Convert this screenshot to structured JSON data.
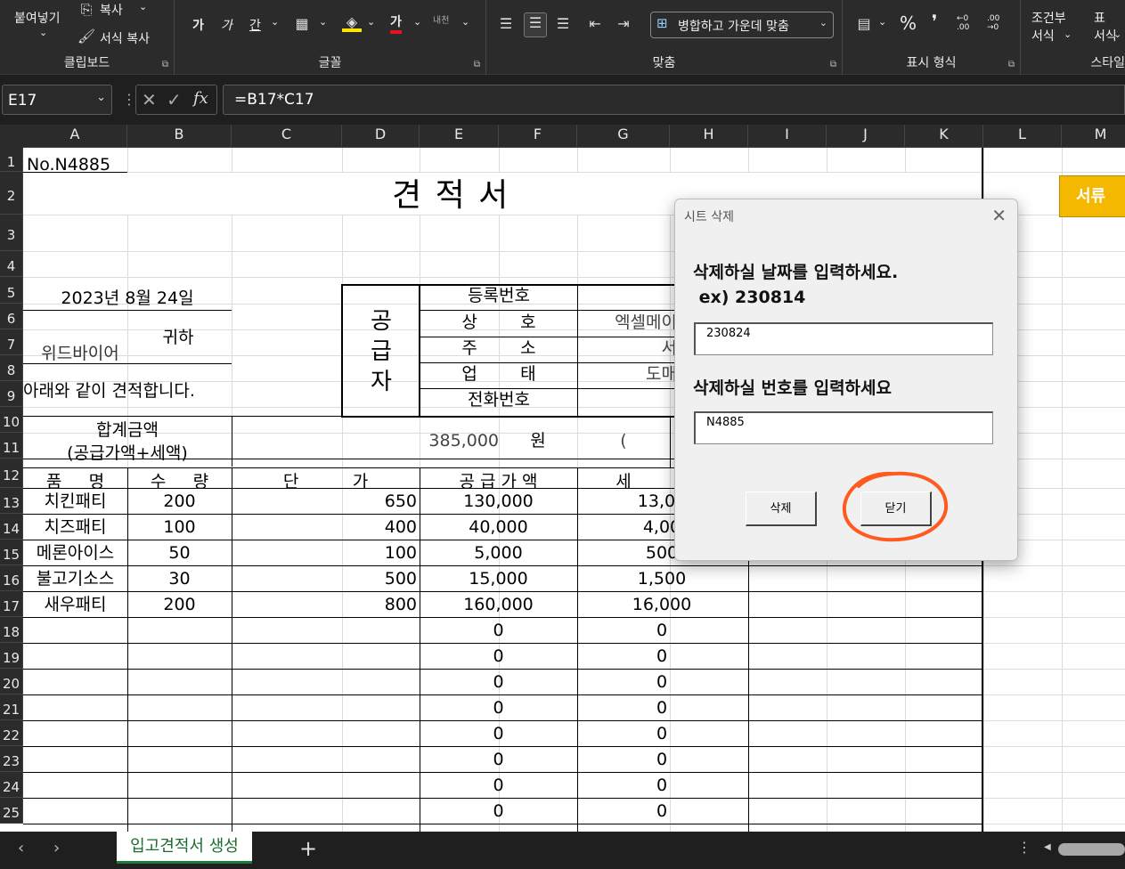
{
  "ribbon": {
    "clipboard": {
      "paste_label": "붙여넣기",
      "copy_label": "복사",
      "format_painter_label": "서식 복사",
      "group_label": "클립보드"
    },
    "font": {
      "group_label": "글꼴",
      "bold_glyph": "가",
      "italic_glyph": "가",
      "underline_glyph": "간",
      "font_color_glyph": "가",
      "phonetic_glyph": "내천"
    },
    "alignment": {
      "group_label": "맞춤",
      "merge_label": "병합하고 가운데 맞춤"
    },
    "number": {
      "group_label": "표시 형식",
      "percent_glyph": "%",
      "comma_glyph": "❜",
      "inc_decimal_glyph": "←0 .00",
      "dec_decimal_glyph": ".00 →0"
    },
    "styles": {
      "conditional_label_1": "조건부",
      "conditional_label_2": "서식",
      "table_label_1": "표",
      "table_label_2": "서식",
      "group_label": "스타일"
    }
  },
  "formula_bar": {
    "name_box": "E17",
    "formula": "=B17*C17",
    "fx": "fx"
  },
  "columns": [
    "A",
    "B",
    "C",
    "D",
    "E",
    "F",
    "G",
    "H",
    "I",
    "J",
    "K",
    "L",
    "M"
  ],
  "rows": [
    "1",
    "2",
    "3",
    "4",
    "5",
    "6",
    "7",
    "8",
    "9",
    "10",
    "11",
    "12",
    "13",
    "14",
    "15",
    "16",
    "17",
    "18",
    "19",
    "20",
    "21",
    "22",
    "23",
    "24",
    "25"
  ],
  "sheet": {
    "doc_no": "No.N4885",
    "title": "견   적   서",
    "date": "2023년  8월  24일",
    "recipient": "위드바이어",
    "honorific": "귀하",
    "statement": "아래와 같이 견적합니다.",
    "supplier_label": [
      "공",
      "급",
      "자"
    ],
    "supplier_fields": [
      "등록번호",
      "상        호",
      "주        소",
      "업        태",
      "전화번호"
    ],
    "supplier_values": [
      "",
      "엑셀메이",
      "서",
      "도매",
      "",
      ""
    ],
    "total_label_1": "합계금액",
    "total_label_2": "(공급가액+세액)",
    "total_value": "385,000",
    "won": "원",
    "paren": "(",
    "headers": [
      "품     명",
      "수     량",
      "단          가",
      "공 급 가 액",
      "세"
    ],
    "items": [
      {
        "name": "치킨패티",
        "qty": "200",
        "price": "650",
        "supply": "130,000",
        "tax": "13,00"
      },
      {
        "name": "치즈패티",
        "qty": "100",
        "price": "400",
        "supply": "40,000",
        "tax": "4,00"
      },
      {
        "name": "메론아이스",
        "qty": "50",
        "price": "100",
        "supply": "5,000",
        "tax": "500"
      },
      {
        "name": "불고기소스",
        "qty": "30",
        "price": "500",
        "supply": "15,000",
        "tax": "1,500"
      },
      {
        "name": "새우패티",
        "qty": "200",
        "price": "800",
        "supply": "160,000",
        "tax": "16,000"
      }
    ],
    "empty_rows": [
      {
        "supply": "0",
        "tax": "0"
      },
      {
        "supply": "0",
        "tax": "0"
      },
      {
        "supply": "0",
        "tax": "0"
      },
      {
        "supply": "0",
        "tax": "0"
      },
      {
        "supply": "0",
        "tax": "0"
      },
      {
        "supply": "0",
        "tax": "0"
      },
      {
        "supply": "0",
        "tax": "0"
      },
      {
        "supply": "0",
        "tax": "0"
      }
    ],
    "side_button": "서류"
  },
  "dialog": {
    "title": "시트 삭제",
    "date_label_1": "삭제하실 날짜를 입력하세요.",
    "date_label_2": " ex) 230814",
    "date_value": "230824",
    "number_label": "삭제하실 번호를 입력하세요",
    "number_value": "N4885",
    "delete_button": "삭제",
    "close_button": "닫기",
    "highlight_color": "#ff5a1f"
  },
  "tabs": {
    "active": "입고견적서 생성",
    "add": "+"
  }
}
